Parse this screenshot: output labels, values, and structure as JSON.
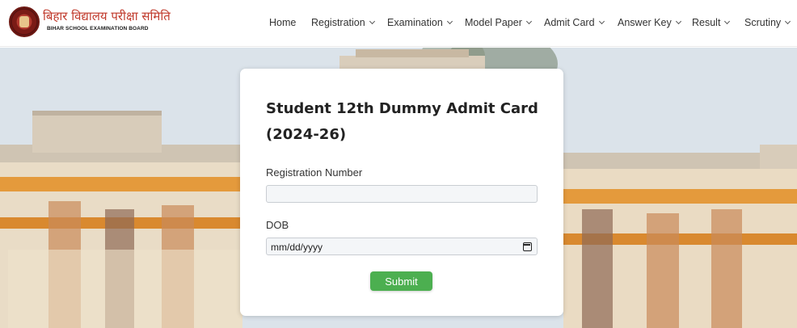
{
  "brand": {
    "hindi_name": "बिहार विद्यालय परीक्षा समिति",
    "english_name": "BIHAR SCHOOL EXAMINATION BOARD"
  },
  "nav": [
    {
      "label": "Home",
      "has_dropdown": false
    },
    {
      "label": "Registration",
      "has_dropdown": true
    },
    {
      "label": "Examination",
      "has_dropdown": true
    },
    {
      "label": "Model Paper",
      "has_dropdown": true
    },
    {
      "label": "Admit Card",
      "has_dropdown": true
    },
    {
      "label": "Answer Key",
      "has_dropdown": true
    },
    {
      "label": "Result",
      "has_dropdown": true
    },
    {
      "label": "Scrutiny",
      "has_dropdown": true
    }
  ],
  "form": {
    "title": "Student 12th Dummy Admit Card (2024-26)",
    "registration_label": "Registration Number",
    "registration_value": "",
    "dob_label": "DOB",
    "dob_placeholder": "mm/dd/yyyy",
    "submit_label": "Submit"
  },
  "colors": {
    "brand_red": "#c0392b",
    "submit_green": "#4caf50"
  }
}
